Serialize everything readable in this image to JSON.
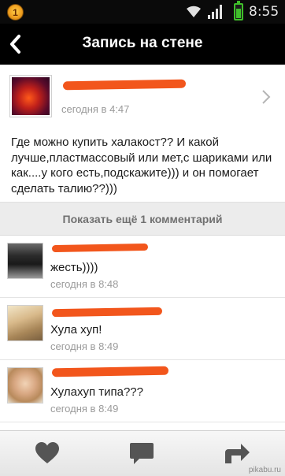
{
  "status_bar": {
    "time": "8:55",
    "notification_badge": "1"
  },
  "header": {
    "title": "Запись на стене"
  },
  "post": {
    "author_time": "сегодня в 4:47",
    "text": "Где можно купить халакост?? И какой лучше,пластмассовый или мет,с шариками или как....у кого есть,подскажите))) и он помогает сделать талию??)))"
  },
  "show_more": {
    "label": "Показать ещё 1 комментарий"
  },
  "comments": [
    {
      "text": "жесть))))",
      "time": "сегодня в 8:48"
    },
    {
      "text": "Хула хуп!",
      "time": "сегодня в 8:49"
    },
    {
      "text": "Хулахуп типа???",
      "time": "сегодня в 8:49"
    }
  ],
  "bottom_bar": {
    "items": [
      "like-icon",
      "comment-icon",
      "share-icon"
    ]
  },
  "watermark": "pikabu.ru",
  "colors": {
    "header_bg": "#000000",
    "redaction": "#f2561c",
    "meta_text": "#9a9a9a",
    "battery": "#3fbf2a"
  }
}
